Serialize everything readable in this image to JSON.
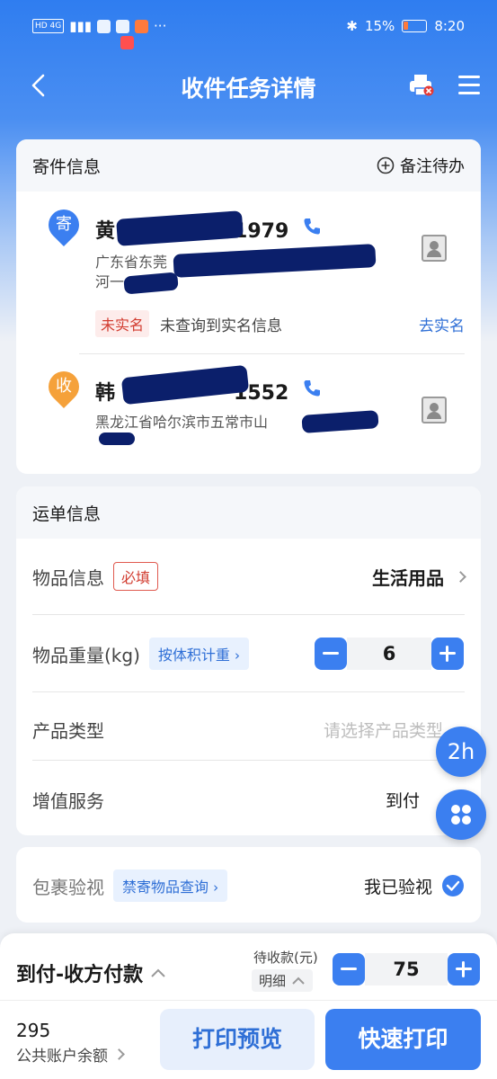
{
  "status_bar": {
    "left": "HD 4G",
    "battery": "15%",
    "time": "8:20"
  },
  "header": {
    "title": "收件任务详情"
  },
  "sender_section": {
    "title": "寄件信息",
    "note_action": "备注待办",
    "sender": {
      "badge": "寄",
      "name_start": "黄",
      "name_end": "1979",
      "addr_line1": "广东省东莞",
      "addr_line2": "河一",
      "unverified_tag": "未实名",
      "unverified_msg": "未查询到实名信息",
      "verify_link": "去实名"
    },
    "receiver": {
      "badge": "收",
      "name_start": "韩",
      "name_end": "1552",
      "addr_line1": "黑龙江省哈尔滨市五常市山"
    }
  },
  "waybill": {
    "title": "运单信息",
    "item_info_label": "物品信息",
    "required_tag": "必填",
    "item_info_value": "生活用品",
    "weight_label": "物品重量(kg)",
    "volume_tag": "按体积计重",
    "weight_value": "6",
    "product_type_label": "产品类型",
    "product_type_placeholder": "请选择产品类型",
    "value_added_label": "增值服务",
    "value_added_value": "到付"
  },
  "inspection": {
    "label": "包裹验视",
    "forbidden_link": "禁寄物品查询",
    "checked_label": "我已验视"
  },
  "floating": {
    "timer": "2h"
  },
  "footer": {
    "payment_mode": "到付-收方付款",
    "pending_label": "待收款(元)",
    "detail_label": "明细",
    "amount": "75",
    "balance": "295",
    "balance_label": "公共账户余额",
    "preview_button": "打印预览",
    "quick_print_button": "快速打印"
  },
  "colors": {
    "primary": "#3b7ff0",
    "accent_red": "#d23c30",
    "orange": "#f5a13a"
  }
}
